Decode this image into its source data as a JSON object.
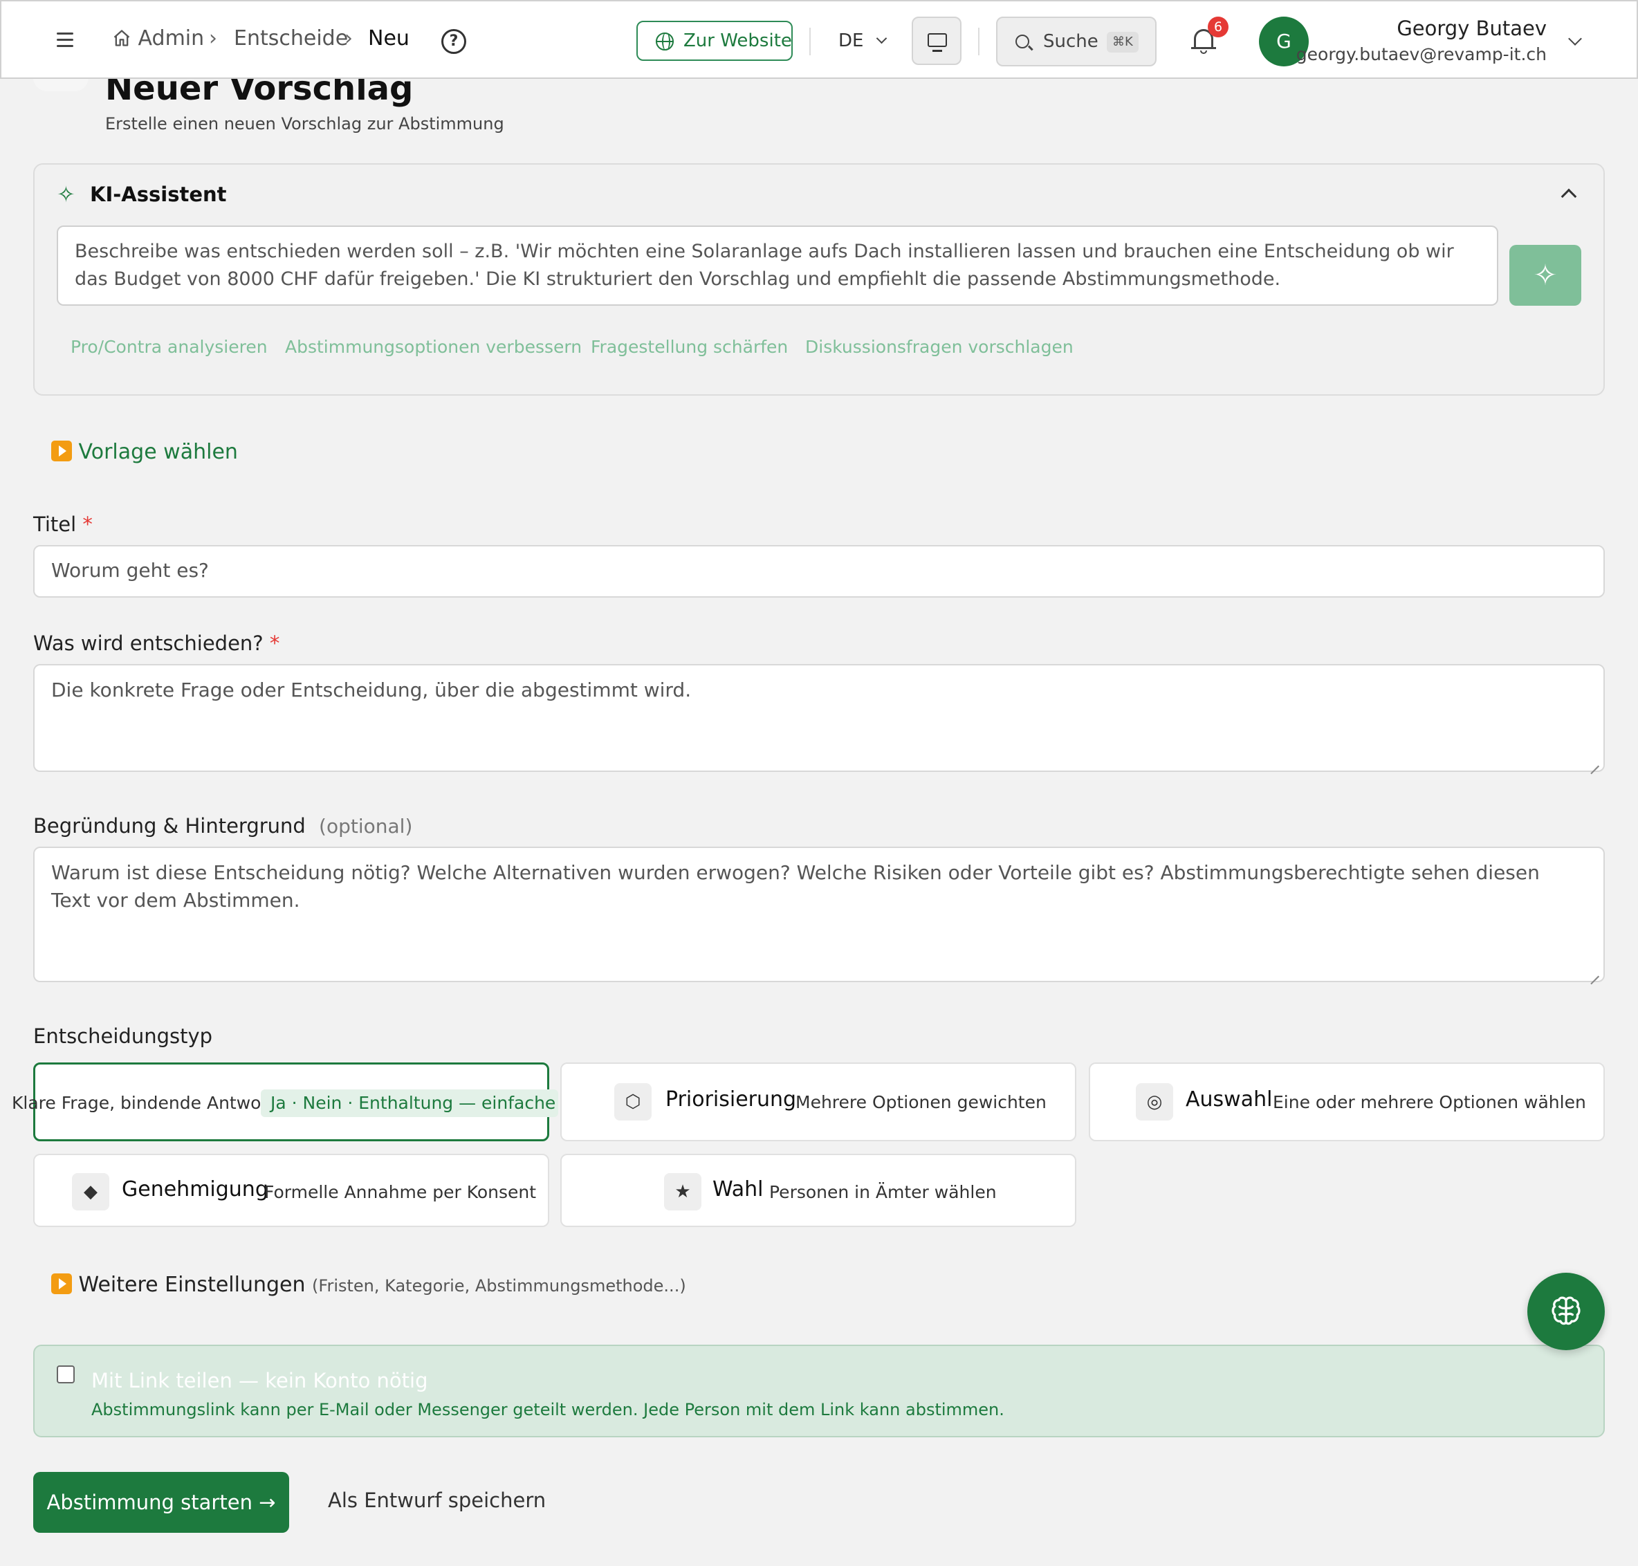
{
  "header": {
    "breadcrumb": [
      "Admin",
      "Entscheide",
      "Neu"
    ],
    "website_label": "Zur Website",
    "language": "DE",
    "search_label": "Suche",
    "search_shortcut": "⌘K",
    "notification_count": "6",
    "avatar_initial": "G",
    "user_name": "Georgy Butaev",
    "user_email": "georgy.butaev@revamp-it.ch"
  },
  "page": {
    "title": "Neuer Vorschlag",
    "subtitle": "Erstelle einen neuen Vorschlag zur Abstimmung"
  },
  "ki": {
    "title": "KI-Assistent",
    "placeholder": "Beschreibe was entschieden werden soll – z.B. 'Wir möchten eine Solaranlage aufs Dach installieren lassen und brauchen eine Entscheidung ob wir das Budget von 8000 CHF dafür freigeben.' Die KI strukturiert den Vorschlag und empfiehlt die passende Abstimmungsmethode.",
    "chips": [
      "Pro/Contra analysieren",
      "Abstimmungsoptionen verbessern",
      "Fragestellung schärfen",
      "Diskussionsfragen vorschlagen"
    ]
  },
  "template_label": "Vorlage wählen",
  "form": {
    "title_label": "Titel",
    "title_placeholder": "Worum geht es?",
    "question_label": "Was wird entschieden?",
    "question_placeholder": "Die konkrete Frage oder Entscheidung, über die abgestimmt wird.",
    "reason_label": "Begründung & Hintergrund",
    "reason_optional": "(optional)",
    "reason_placeholder": "Warum ist diese Entscheidung nötig? Welche Alternativen wurden erwogen? Welche Risiken oder Vorteile gibt es? Abstimmungsberechtigte sehen diesen Text vor dem Abstimmen.",
    "required_mark": "*"
  },
  "decision": {
    "label": "Entscheidungstyp",
    "types": [
      {
        "name": "",
        "desc": "Klare Frage, bindende Antwort",
        "tag": "Ja · Nein · Enthaltung — einfache Mehrheit",
        "icon": ""
      },
      {
        "name": "Priorisierung",
        "desc": "Mehrere Optionen gewichten",
        "icon": "⬡"
      },
      {
        "name": "Auswahl",
        "desc": "Eine oder mehrere Optionen wählen",
        "icon": "◎"
      },
      {
        "name": "Genehmigung",
        "desc": "Formelle Annahme per Konsent",
        "icon": "◆"
      },
      {
        "name": "Wahl",
        "desc": "Personen in Ämter wählen",
        "icon": "★"
      }
    ]
  },
  "more_settings": {
    "label": "Weitere Einstellungen",
    "hint": "(Fristen, Kategorie, Abstimmungsmethode...)"
  },
  "share": {
    "title": "Mit Link teilen — kein Konto nötig",
    "desc": "Abstimmungslink kann per E-Mail oder Messenger geteilt werden. Jede Person mit dem Link kann abstimmen."
  },
  "actions": {
    "start": "Abstimmung starten →",
    "draft": "Als Entwurf speichern"
  },
  "colors": {
    "accent": "#1d7a3e",
    "accent_light": "#7fbf99",
    "required": "#e53935"
  }
}
